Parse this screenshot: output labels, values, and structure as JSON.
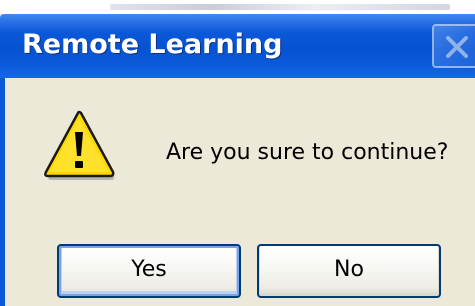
{
  "window": {
    "title": "Remote Learning",
    "close_icon": "close-icon"
  },
  "message": {
    "icon": "warning-icon",
    "text": "Are you sure to continue?"
  },
  "buttons": {
    "yes_label": "Yes",
    "no_label": "No"
  },
  "colors": {
    "titlebar": "#0653d2",
    "dialog_bg": "#ece9d8",
    "warning_yellow": "#ffd800"
  }
}
